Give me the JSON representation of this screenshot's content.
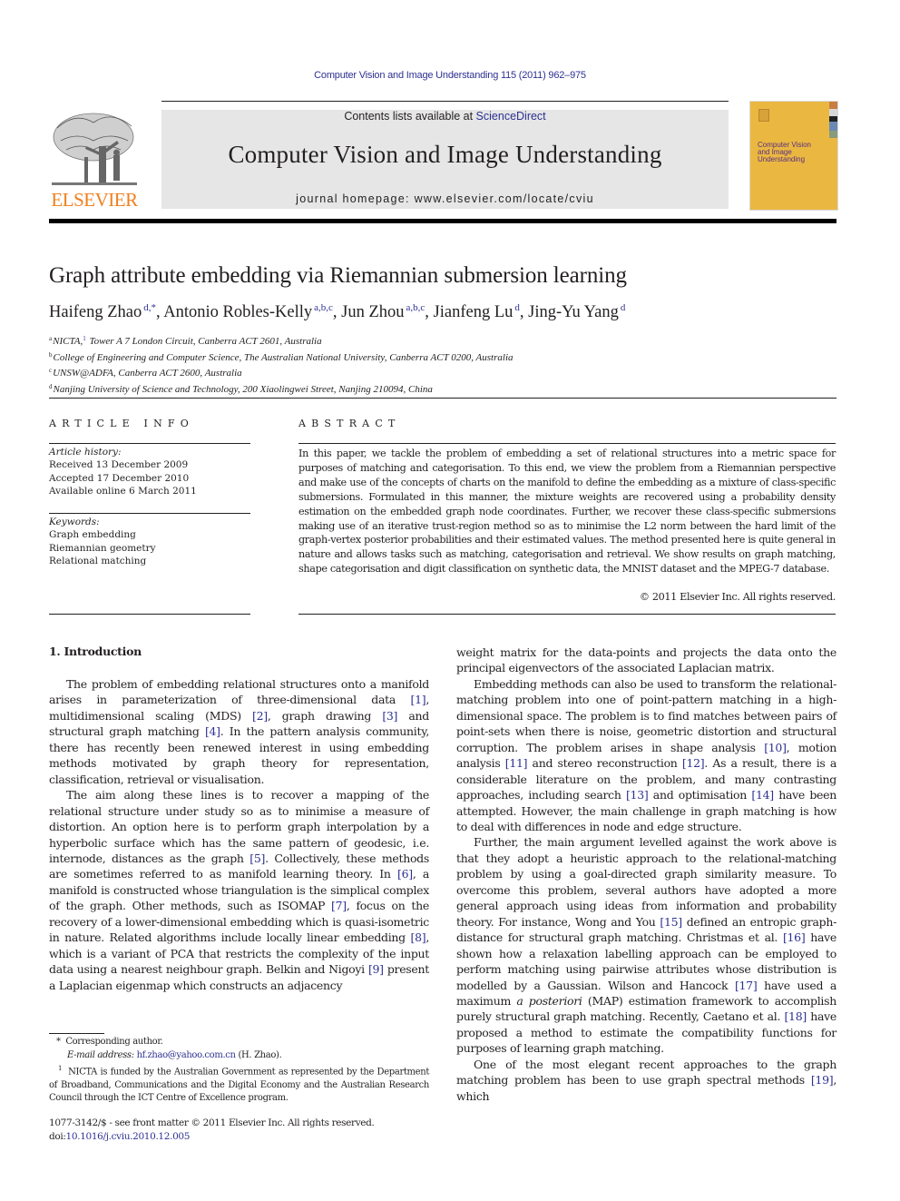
{
  "running_head": "Computer Vision and Image Understanding 115 (2011) 962–975",
  "banner": {
    "contents_prefix": "Contents lists available at ",
    "contents_link": "ScienceDirect",
    "journal_title": "Computer Vision and Image Understanding",
    "homepage_prefix": "journal homepage: ",
    "homepage_url": "www.elsevier.com/locate/cviu"
  },
  "publisher_logo": {
    "text": "ELSEVIER",
    "color": "#f07f1d"
  },
  "cover": {
    "title_lines": [
      "Computer Vision",
      "and Image",
      "Understanding"
    ],
    "background": "#eab841"
  },
  "article": {
    "title": "Graph attribute embedding via Riemannian submersion learning",
    "authors": [
      {
        "name": "Haifeng Zhao",
        "sup": "d,*"
      },
      {
        "name": "Antonio Robles-Kelly",
        "sup": "a,b,c"
      },
      {
        "name": "Jun Zhou",
        "sup": "a,b,c"
      },
      {
        "name": "Jianfeng Lu",
        "sup": "d"
      },
      {
        "name": "Jing-Yu Yang",
        "sup": "d"
      }
    ],
    "affiliations": [
      {
        "mark": "a",
        "text": "NICTA,",
        "footnote": "1",
        "rest": " Tower A 7 London Circuit, Canberra ACT 2601, Australia"
      },
      {
        "mark": "b",
        "text": "College of Engineering and Computer Science, The Australian National University, Canberra ACT 0200, Australia"
      },
      {
        "mark": "c",
        "text": "UNSW@ADFA, Canberra ACT 2600, Australia"
      },
      {
        "mark": "d",
        "text": "Nanjing University of Science and Technology, 200 Xiaolingwei Street, Nanjing 210094, China"
      }
    ]
  },
  "article_info": {
    "heading": "ARTICLE INFO",
    "history_label": "Article history:",
    "history": [
      "Received 13 December 2009",
      "Accepted 17 December 2010",
      "Available online 6 March 2011"
    ],
    "keywords_label": "Keywords:",
    "keywords": [
      "Graph embedding",
      "Riemannian geometry",
      "Relational matching"
    ]
  },
  "abstract": {
    "heading": "ABSTRACT",
    "text": "In this paper, we tackle the problem of embedding a set of relational structures into a metric space for purposes of matching and categorisation. To this end, we view the problem from a Riemannian perspective and make use of the concepts of charts on the manifold to define the embedding as a mixture of class-specific submersions. Formulated in this manner, the mixture weights are recovered using a probability density estimation on the embedded graph node coordinates. Further, we recover these class-specific submersions making use of an iterative trust-region method so as to minimise the L2 norm between the hard limit of the graph-vertex posterior probabilities and their estimated values. The method presented here is quite general in nature and allows tasks such as matching, categorisation and retrieval. We show results on graph matching, shape categorisation and digit classification on synthetic data, the MNIST dataset and the MPEG-7 database.",
    "copyright": "© 2011 Elsevier Inc. All rights reserved."
  },
  "introduction": {
    "heading": "1. Introduction",
    "left_paragraphs": [
      [
        {
          "t": "The problem of embedding relational structures onto a manifold arises in parameterization of three-dimensional data "
        },
        {
          "r": "[1]"
        },
        {
          "t": ", multidimensional scaling (MDS) "
        },
        {
          "r": "[2]"
        },
        {
          "t": ", graph drawing "
        },
        {
          "r": "[3]"
        },
        {
          "t": " and structural graph matching "
        },
        {
          "r": "[4]"
        },
        {
          "t": ". In the pattern analysis community, there has recently been renewed interest in using embedding methods motivated by graph theory for representation, classification, retrieval or visualisation."
        }
      ],
      [
        {
          "t": "The aim along these lines is to recover a mapping of the relational structure under study so as to minimise a measure of distortion. An option here is to perform graph interpolation by a hyperbolic surface which has the same pattern of geodesic, i.e. internode, distances as the graph "
        },
        {
          "r": "[5]"
        },
        {
          "t": ". Collectively, these methods are sometimes referred to as manifold learning theory. In "
        },
        {
          "r": "[6]"
        },
        {
          "t": ", a manifold is constructed whose triangulation is the simplical complex of the graph. Other methods, such as ISOMAP "
        },
        {
          "r": "[7]"
        },
        {
          "t": ", focus on the recovery of a lower-dimensional embedding which is quasi-isometric in nature. Related algorithms include locally linear embedding "
        },
        {
          "r": "[8]"
        },
        {
          "t": ", which is a variant of PCA that restricts the complexity of the input data using a nearest neighbour graph. Belkin and Nigoyi "
        },
        {
          "r": "[9]"
        },
        {
          "t": " present a Laplacian eigenmap which constructs an adjacency"
        }
      ]
    ],
    "right_paragraphs": [
      [
        {
          "t": "weight matrix for the data-points and projects the data onto the principal eigenvectors of the associated Laplacian matrix."
        }
      ],
      [
        {
          "t": "Embedding methods can also be used to transform the relational-matching problem into one of point-pattern matching in a high-dimensional space. The problem is to find matches between pairs of point-sets when there is noise, geometric distortion and structural corruption. The problem arises in shape analysis "
        },
        {
          "r": "[10]"
        },
        {
          "t": ", motion analysis "
        },
        {
          "r": "[11]"
        },
        {
          "t": " and stereo reconstruction "
        },
        {
          "r": "[12]"
        },
        {
          "t": ". As a result, there is a considerable literature on the problem, and many contrasting approaches, including search "
        },
        {
          "r": "[13]"
        },
        {
          "t": " and optimisation "
        },
        {
          "r": "[14]"
        },
        {
          "t": " have been attempted. However, the main challenge in graph matching is how to deal with differences in node and edge structure."
        }
      ],
      [
        {
          "t": "Further, the main argument levelled against the work above is that they adopt a heuristic approach to the relational-matching problem by using a goal-directed graph similarity measure. To overcome this problem, several authors have adopted a more general approach using ideas from information and probability theory. For instance, Wong and You "
        },
        {
          "r": "[15]"
        },
        {
          "t": " defined an entropic graph-distance for structural graph matching. Christmas et al. "
        },
        {
          "r": "[16]"
        },
        {
          "t": " have shown how a relaxation labelling approach can be employed to perform matching using pairwise attributes whose distribution is modelled by a Gaussian. Wilson and Hancock "
        },
        {
          "r": "[17]"
        },
        {
          "t": " have used a maximum "
        },
        {
          "i": "a posteriori"
        },
        {
          "t": " (MAP) estimation framework to accomplish purely structural graph matching. Recently, Caetano et al. "
        },
        {
          "r": "[18]"
        },
        {
          "t": " have proposed a method to estimate the compatibility functions for purposes of learning graph matching."
        }
      ],
      [
        {
          "t": "One of the most elegant recent approaches to the graph matching problem has been to use graph spectral methods "
        },
        {
          "r": "[19]"
        },
        {
          "t": ", which"
        }
      ]
    ]
  },
  "footnotes": {
    "corresponding_mark": "*",
    "corresponding_text": "Corresponding author.",
    "email_label": "E-mail address:",
    "email": "hf.zhao@yahoo.com.cn",
    "email_suffix": " (H. Zhao).",
    "fn1_mark": "1",
    "fn1_text": "NICTA is funded by the Australian Government as represented by the Department of Broadband, Communications and the Digital Economy and the Australian Research Council through the ICT Centre of Excellence program."
  },
  "front_matter": {
    "issn_line": "1077-3142/$ - see front matter © 2011 Elsevier Inc. All rights reserved.",
    "doi_prefix": "doi:",
    "doi": "10.1016/j.cviu.2010.12.005"
  },
  "colors": {
    "link": "#2e3192",
    "text": "#231f20",
    "banner_bg": "#e6e6e6",
    "elsevier_orange": "#f07f1d"
  }
}
